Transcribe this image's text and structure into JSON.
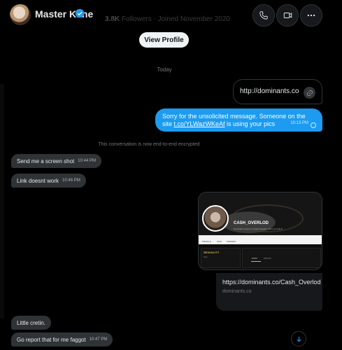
{
  "header": {
    "name": "Master Kane",
    "ghost_followers": "3.8K",
    "ghost_followers_label": "Followers",
    "ghost_joined": "Joined November 2020"
  },
  "view_profile_label": "View Profile",
  "day_separator": "Today",
  "messages": {
    "link_message": {
      "text": "http://dominants.co"
    },
    "blue_message": {
      "text_before": "Sorry for the unsolicited message. Someone on the site ",
      "link": "t.co/YLWazWKeAf",
      "text_after": " is using your pics",
      "time": "10:13 PM"
    },
    "encryption_notice": "This conversation is now end-to-end encrypted",
    "received": [
      {
        "text": "Send me a screen shot",
        "time": "10:44 PM"
      },
      {
        "text": "Link doesnt work",
        "time": "10:46 PM"
      },
      {
        "text": "Little cretin.",
        "time": ""
      },
      {
        "text": "Go report that for me faggot",
        "time": "10:47 PM"
      }
    ]
  },
  "card": {
    "username": "CASH_OVERLOD",
    "bio": "Dominant | Level 3 | United Kingdom, Born on July 8",
    "tabs": [
      "PROFILE",
      "INFO",
      "FRIENDS"
    ],
    "panel_heading": "SEXUALITY",
    "panel_value": "Gay",
    "panel_tab_a": "POST",
    "panel_tab_b": "PHOTO"
  },
  "link_preview": {
    "url": "https://dominants.co/Cash_Overlod",
    "domain": "dominants.co"
  },
  "colors": {
    "background": "#000000",
    "accent": "#1d9bf0",
    "received_bubble": "#2f3336",
    "muted_text": "#71767b"
  }
}
